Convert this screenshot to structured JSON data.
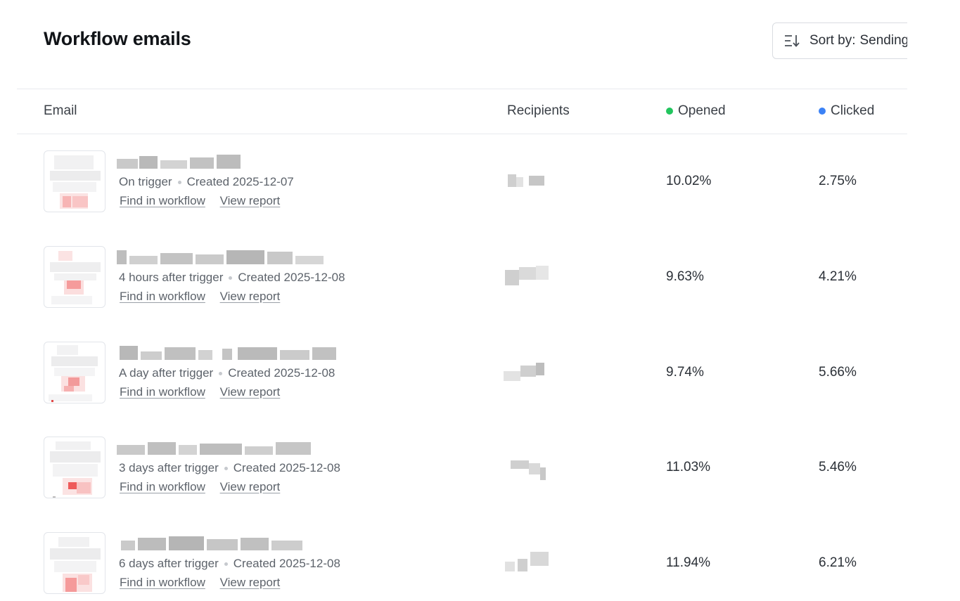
{
  "header": {
    "title": "Workflow emails",
    "sort_label": "Sort by:",
    "sort_value": "Sending order",
    "sort_icon": "sort-descending-icon"
  },
  "table": {
    "columns": {
      "email": "Email",
      "recipients": "Recipients",
      "opened": "Opened",
      "clicked": "Clicked"
    },
    "colors": {
      "opened_dot": "#22c55e",
      "clicked_dot": "#3b82f6"
    },
    "rows": [
      {
        "timing": "On trigger",
        "created": "Created 2025-12-07",
        "find_link": "Find in workflow",
        "report_link": "View report",
        "opened": "10.02%",
        "clicked": "2.75%"
      },
      {
        "timing": "4 hours after trigger",
        "created": "Created 2025-12-08",
        "find_link": "Find in workflow",
        "report_link": "View report",
        "opened": "9.63%",
        "clicked": "4.21%"
      },
      {
        "timing": "A day after trigger",
        "created": "Created 2025-12-08",
        "find_link": "Find in workflow",
        "report_link": "View report",
        "opened": "9.74%",
        "clicked": "5.66%"
      },
      {
        "timing": "3 days after trigger",
        "created": "Created 2025-12-08",
        "find_link": "Find in workflow",
        "report_link": "View report",
        "opened": "11.03%",
        "clicked": "5.46%"
      },
      {
        "timing": "6 days after trigger",
        "created": "Created 2025-12-08",
        "find_link": "Find in workflow",
        "report_link": "View report",
        "opened": "11.94%",
        "clicked": "6.21%"
      }
    ]
  }
}
